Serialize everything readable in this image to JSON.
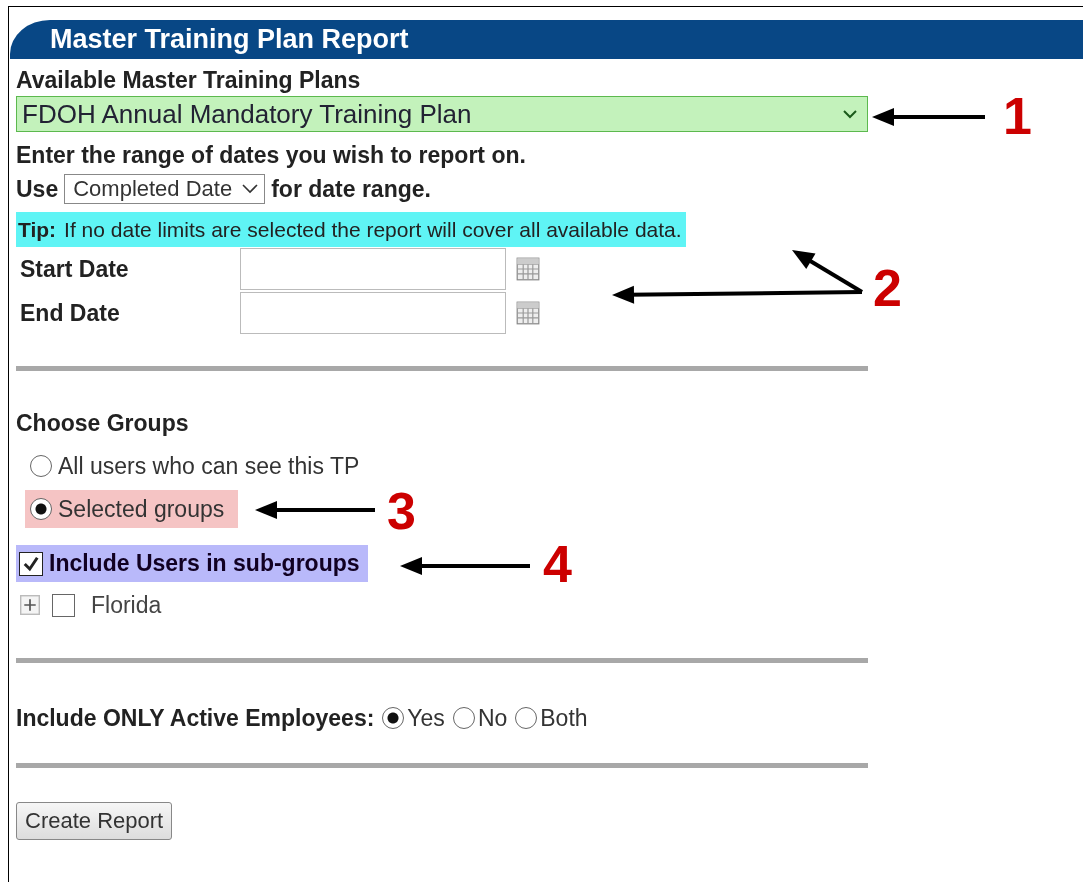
{
  "header": {
    "title": "Master Training Plan Report"
  },
  "plan_select": {
    "label": "Available Master Training Plans",
    "value": "FDOH Annual Mandatory Training Plan"
  },
  "date_range": {
    "instruction": "Enter the range of dates you wish to report on.",
    "use_prefix": "Use",
    "basis_select": "Completed Date",
    "use_suffix": "for date range.",
    "tip": {
      "label": "Tip:",
      "text": "If no date limits are selected the report will cover all available data."
    },
    "fields": [
      {
        "label": "Start Date"
      },
      {
        "label": "End Date"
      }
    ]
  },
  "groups": {
    "title": "Choose Groups",
    "options": [
      {
        "label": "All users who can see this TP",
        "selected": false
      },
      {
        "label": "Selected groups",
        "selected": true,
        "color": "#f5c4c4"
      }
    ],
    "include_subgroups": {
      "label": "Include Users in sub-groups",
      "checked": true
    },
    "tree": [
      {
        "label": "Florida",
        "checked": false,
        "expanded": false
      }
    ]
  },
  "active_employees": {
    "label": "Include ONLY Active Employees:",
    "options": [
      {
        "label": "Yes",
        "selected": true
      },
      {
        "label": "No",
        "selected": false
      },
      {
        "label": "Both",
        "selected": false
      }
    ]
  },
  "create_button": "Create Report",
  "annotations": [
    {
      "number": "1"
    },
    {
      "number": "2"
    },
    {
      "number": "3"
    },
    {
      "number": "4"
    }
  ]
}
